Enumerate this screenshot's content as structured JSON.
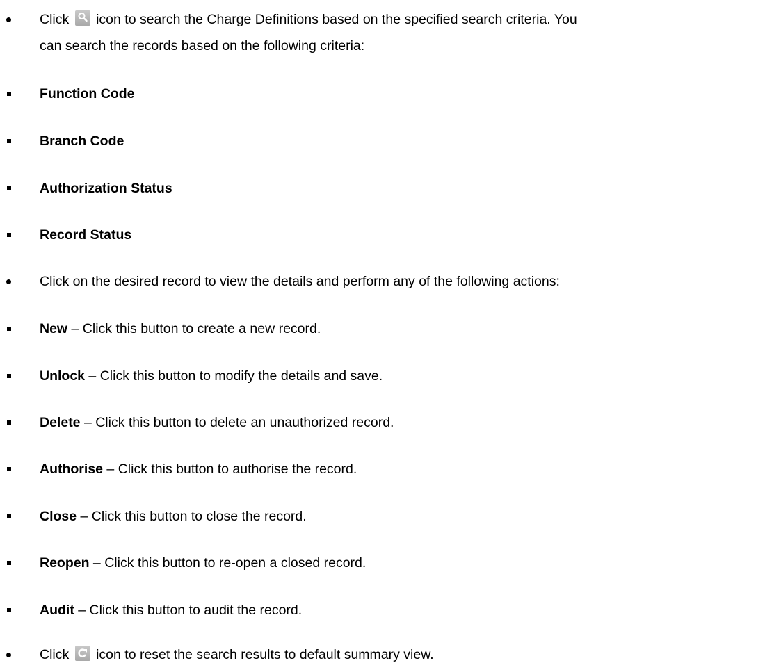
{
  "intro": {
    "before_icon": "Click",
    "after_icon": "icon to search the Charge Definitions based on the specified search criteria. You",
    "continuation": "can search the records based on the following criteria:",
    "icon": "search-icon"
  },
  "criteria": [
    "Function Code",
    "Branch Code",
    "Authorization Status",
    "Record Status"
  ],
  "actions_intro": "Click on the desired record to view the details and perform any of the following actions:",
  "actions": [
    {
      "label": "New",
      "desc": " – Click this button to create a new record."
    },
    {
      "label": "Unlock",
      "desc": " – Click this button to modify the details and save."
    },
    {
      "label": "Delete",
      "desc": " – Click this button to delete an unauthorized record."
    },
    {
      "label": "Authorise",
      "desc": " – Click this button to authorise the record."
    },
    {
      "label": "Close",
      "desc": " – Click this button to close the record."
    },
    {
      "label": "Reopen",
      "desc": " – Click this button to re-open a closed record."
    },
    {
      "label": "Audit",
      "desc": " – Click this button to audit the record."
    }
  ],
  "reset": {
    "before_icon": "Click",
    "after_icon": "icon to reset the search results to default summary view.",
    "icon": "refresh-icon"
  }
}
